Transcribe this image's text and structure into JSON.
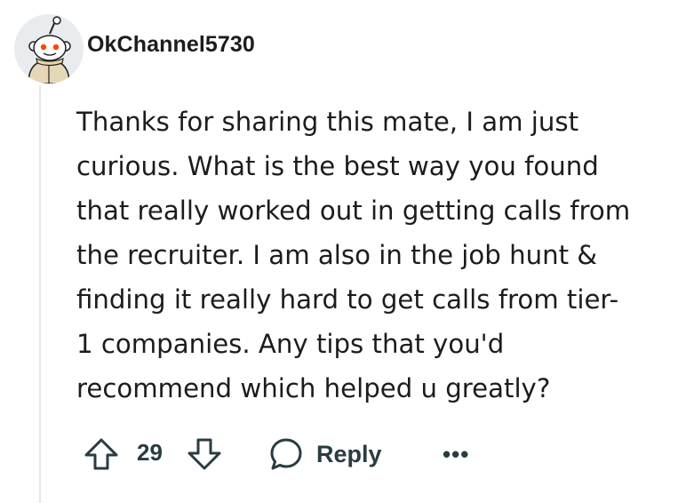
{
  "comment": {
    "author": "OkChannel5730",
    "avatar_icon": "snoo-avatar-icon",
    "body": "Thanks for sharing this mate, I am just\ncurious. What is the best way you found\nthat really worked out in getting calls from\nthe recruiter. I am also in the job hunt &\nfinding it really hard to get calls from tier-\n1 companies. Any tips that you'd\nrecommend which helped u greatly?",
    "score": "29",
    "actions": {
      "upvote_icon": "upvote-arrow-icon",
      "downvote_icon": "downvote-arrow-icon",
      "reply_icon": "speech-bubble-icon",
      "reply_label": "Reply",
      "more_label": "•••"
    }
  },
  "colors": {
    "text": "#1c1c1c",
    "action_text": "#2a3c42",
    "thread_line": "#e5e7e9",
    "snoo_orange": "#ff4500"
  }
}
